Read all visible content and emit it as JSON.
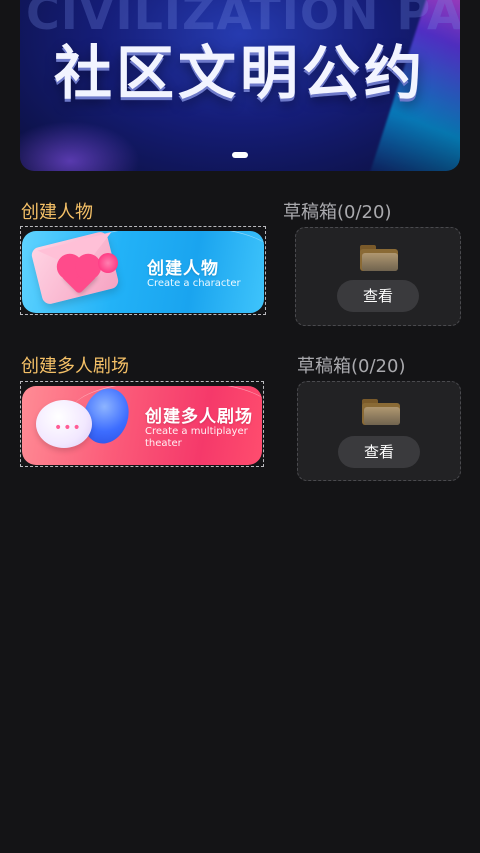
{
  "banner": {
    "background_text": "CIVILIZATION PACT",
    "title": "社区文明公约"
  },
  "sections": {
    "character": {
      "title": "创建人物",
      "card_heading": "创建人物",
      "card_subtitle": "Create a character",
      "draft_title": "草稿箱(0/20)",
      "draft_button": "查看"
    },
    "theater": {
      "title": "创建多人剧场",
      "card_heading": "创建多人剧场",
      "card_subtitle": "Create a multiplayer theater",
      "draft_title": "草稿箱(0/20)",
      "draft_button": "查看"
    }
  },
  "icons": {
    "banner_indicator": "carousel-dot-icon",
    "character_illustration": "envelope-heart-icon",
    "theater_illustration": "chat-bubbles-icon",
    "draft_folder": "folder-icon"
  },
  "colors": {
    "background": "#141416",
    "section_title": "#f4c067",
    "draft_title": "#a9a9ad",
    "character_card": "#22b2f7",
    "theater_card": "#f5396a",
    "button_bg": "#3a3a3d"
  }
}
